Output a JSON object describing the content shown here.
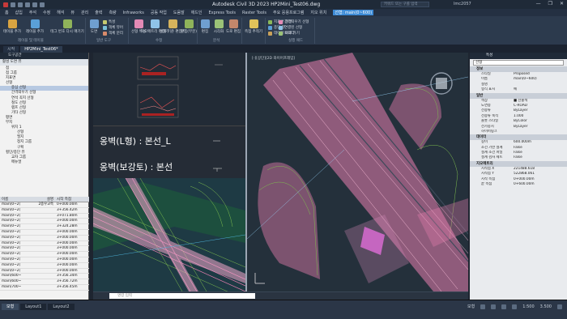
{
  "window": {
    "title": "Autodesk Civil 3D 2023   HP2Mini_Test06.dwg",
    "search_placeholder": "키워드 또는 구를 입력",
    "user": "lmc2057",
    "controls": [
      "—",
      "❐",
      "✕"
    ]
  },
  "menu": {
    "items": [
      "홈",
      "삽입",
      "주석",
      "수정",
      "해석",
      "뷰",
      "관리",
      "출력",
      "측량",
      "Infraworks",
      "공동 작업",
      "도움말",
      "애드인",
      "Express Tools",
      "Raster Tools",
      "주요 응용프로그램",
      "지오 위치",
      "선형: main(0~600)"
    ],
    "active_index": 17
  },
  "ribbon": {
    "groups": [
      {
        "label": "레이블 및 테이블",
        "buttons": [
          "테이블 추가",
          "레이블 추가",
          "테그 번호 다시 매기기"
        ]
      },
      {
        "label": "일반 도구",
        "buttons": [
          "도면",
          "특성",
          "객체 뷰어",
          "객체 분리"
        ]
      },
      {
        "label": "수정",
        "buttons": [
          "선형 특성",
          "지오메트리 편집기",
          "설계 기준 편집기",
          "편집(부분)"
        ]
      },
      {
        "label": "분석",
        "buttons": [
          "편집",
          "시각화",
          "도로 편집"
        ]
      },
      {
        "label": "",
        "buttons": [
          "측점 추적기"
        ]
      },
      {
        "label": "",
        "buttons": [
          "지표면 종단",
          "종단 뷰",
          "데이터 바로 가기"
        ]
      },
      {
        "label": "실행 패드",
        "buttons": [
          "간격띄우기 선형",
          "연결된 선형",
          "토리더"
        ]
      }
    ]
  },
  "document_tabs": [
    "시작",
    "HP2Mini_Test06*"
  ],
  "toolspace": {
    "title": "도구공간",
    "tab": "활성 도면 뷰",
    "tree": [
      {
        "label": "점",
        "level": 1
      },
      {
        "label": "점 그룹",
        "level": 1
      },
      {
        "label": "지표면",
        "level": 1
      },
      {
        "label": "선형",
        "level": 1
      },
      {
        "label": "중심 선형",
        "level": 2,
        "selected": true
      },
      {
        "label": "간격띄우기 선형",
        "level": 2
      },
      {
        "label": "연석 꼭지 선형",
        "level": 2
      },
      {
        "label": "철도 선형",
        "level": 2
      },
      {
        "label": "램프 선형",
        "level": 2
      },
      {
        "label": "기타 선형",
        "level": 2
      },
      {
        "label": "평면",
        "level": 1
      },
      {
        "label": "부지",
        "level": 1
      },
      {
        "label": "위치 1",
        "level": 2
      },
      {
        "label": "선형",
        "level": 3
      },
      {
        "label": "필지",
        "level": 3
      },
      {
        "label": "정지 그룹",
        "level": 3
      },
      {
        "label": "구획",
        "level": 3
      },
      {
        "label": "횡단/종단 뷰",
        "level": 1
      },
      {
        "label": "교차 그룹",
        "level": 2
      },
      {
        "label": "메뉴얼",
        "level": 2
      }
    ],
    "table": {
      "headers": [
        "이름",
        "설명",
        "시작 측점"
      ],
      "rows": [
        [
          "main(0~2(",
          "2종우교측",
          "0+000.00m"
        ],
        [
          "main(0~2(",
          "",
          "3+356.42m"
        ],
        [
          "main(0~2(",
          "",
          "3+071.80m"
        ],
        [
          "main(0~2(",
          "",
          "3+000.00m"
        ],
        [
          "main(0~2(",
          "",
          "3+324.28m"
        ],
        [
          "main(0~2(",
          "",
          "3+000.00m"
        ],
        [
          "main(0~2(",
          "",
          "3+000.00m"
        ],
        [
          "main(0~2(",
          "",
          "3+000.00m"
        ],
        [
          "main(0~2(",
          "",
          "3+000.00m"
        ],
        [
          "main(0~2(",
          "",
          "3+000.00m"
        ],
        [
          "main(0~2(",
          "",
          "3+000.00m"
        ],
        [
          "main(0~2(",
          "",
          "3+000.00m"
        ],
        [
          "main(0~2(",
          "",
          "3+000.00m"
        ],
        [
          "main(600~",
          "",
          "3+356.34m"
        ],
        [
          "main(600~",
          "",
          "3+356.72m"
        ],
        [
          "main(700~",
          "",
          "3+356.45m"
        ]
      ]
    }
  },
  "viewport": {
    "label1": "옹벽(L형) : 본선_L",
    "label2": "옹벽(보강토) : 본선",
    "plan_header": "[-][상단][2D 와이어프레임]"
  },
  "properties": {
    "title": "특성",
    "selection": "선형",
    "sections": [
      {
        "title": "정보",
        "rows": [
          [
            "스타일",
            "Proposed"
          ],
          [
            "이름",
            "main(0~600)"
          ],
          [
            "설명",
            ""
          ],
          [
            "형식 표시",
            "예"
          ]
        ]
      },
      {
        "title": "일반",
        "rows": [
          [
            "색상",
            "■ 선홍색"
          ],
          [
            "도면층",
            "C-ROAD"
          ],
          [
            "선종류",
            "ByLayer"
          ],
          [
            "선종류 축척",
            "1.000"
          ],
          [
            "플롯 스타일",
            "ByColor"
          ],
          [
            "선가중치",
            "ByLayer"
          ],
          [
            "하이퍼링크",
            ""
          ]
        ]
      },
      {
        "title": "데이터",
        "rows": [
          [
            "길이",
            "600.000m"
          ],
          [
            "조건 기반 설계",
            "False"
          ],
          [
            "설계 조건 파일",
            "False"
          ],
          [
            "설계 검사 세트",
            "False"
          ]
        ]
      },
      {
        "title": "지오메트리",
        "rows": [
          [
            "시작점 X",
            "221488.618"
          ],
          [
            "시작점 Y",
            "522868.061"
          ],
          [
            "시작 측점",
            "0+000.00m"
          ],
          [
            "끝 측점",
            "0+600.00m"
          ]
        ]
      }
    ]
  },
  "command": {
    "placeholder": "명령 입력"
  },
  "status": {
    "layout_tabs": [
      "모형",
      "Layout1",
      "Layout2"
    ],
    "active_tab": 0,
    "right_items": [
      "모형",
      "1:500",
      "3.500"
    ]
  },
  "colors": {
    "alignment": "#e87fb0",
    "grass": "#7fbf4f",
    "background": "#24303b"
  }
}
